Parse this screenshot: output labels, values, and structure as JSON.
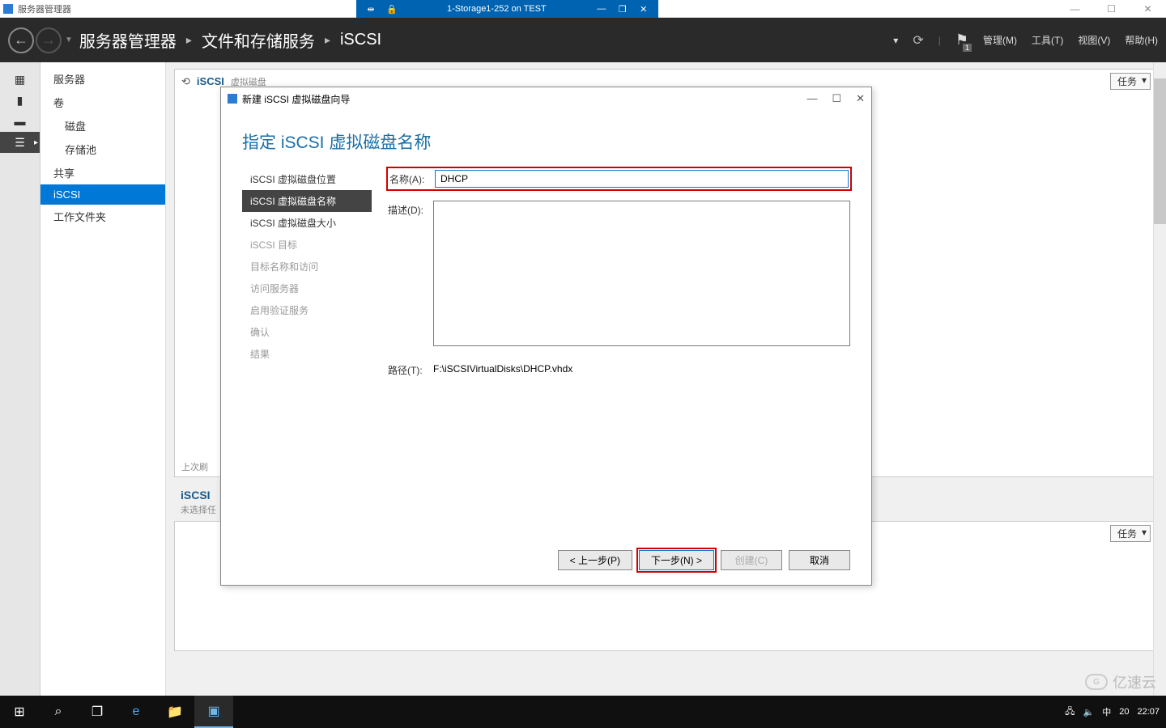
{
  "outerWindow": {
    "title": "服务器管理器"
  },
  "vmBar": {
    "title": "1-Storage1-252 on TEST",
    "min": "—",
    "max": "❐",
    "close": "✕"
  },
  "header": {
    "breadcrumb": [
      "服务器管理器",
      "文件和存储服务",
      "iSCSI"
    ],
    "menus": {
      "manage": "管理(M)",
      "tools": "工具(T)",
      "view": "视图(V)",
      "help": "帮助(H)"
    }
  },
  "sidebar": {
    "items": [
      {
        "label": "服务器",
        "sub": false
      },
      {
        "label": "卷",
        "sub": false
      },
      {
        "label": "磁盘",
        "sub": true
      },
      {
        "label": "存储池",
        "sub": true
      },
      {
        "label": "共享",
        "sub": false
      },
      {
        "label": "iSCSI",
        "sub": false,
        "selected": true
      },
      {
        "label": "工作文件夹",
        "sub": false
      }
    ]
  },
  "panels": {
    "p1": {
      "title": "iSCSI",
      "subtitle": "虚拟磁盘",
      "tasks": "任务",
      "footer": "上次刷"
    },
    "p2": {
      "title": "iSCSI",
      "subtitle": "未选择任",
      "tasks": "任务"
    }
  },
  "wizard": {
    "title": "新建 iSCSI 虚拟磁盘向导",
    "heading": "指定 iSCSI 虚拟磁盘名称",
    "steps": [
      "iSCSI 虚拟磁盘位置",
      "iSCSI 虚拟磁盘名称",
      "iSCSI 虚拟磁盘大小",
      "iSCSI 目标",
      "目标名称和访问",
      "访问服务器",
      "启用验证服务",
      "确认",
      "结果"
    ],
    "activeStep": 1,
    "labels": {
      "name": "名称(A):",
      "desc": "描述(D):",
      "path": "路径(T):"
    },
    "values": {
      "name": "DHCP",
      "desc": "",
      "path": "F:\\iSCSIVirtualDisks\\DHCP.vhdx"
    },
    "buttons": {
      "prev": "< 上一步(P)",
      "next": "下一步(N) >",
      "create": "创建(C)",
      "cancel": "取消"
    }
  },
  "taskbar": {
    "time": "22:07",
    "date": "20",
    "ime": "中"
  },
  "watermark": "亿速云"
}
